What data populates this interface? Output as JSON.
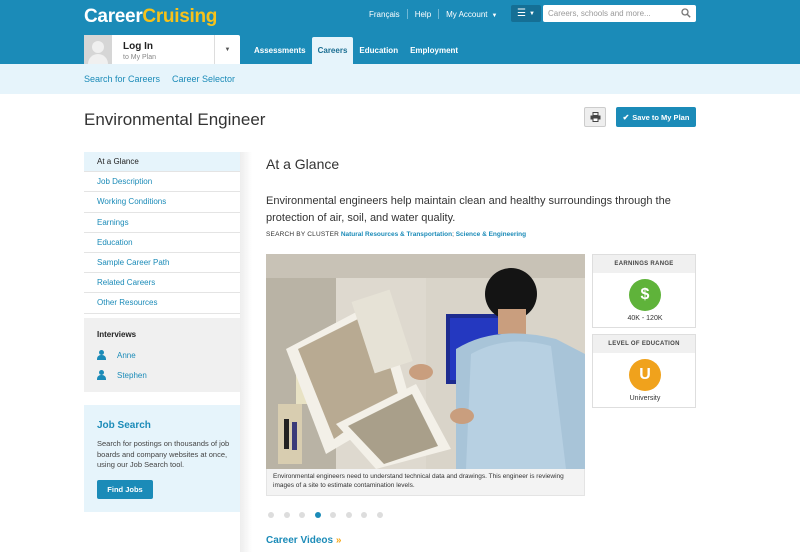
{
  "header": {
    "logo_part1": "Career",
    "logo_part2": "Cruising",
    "links": [
      "Français",
      "Help",
      "My Account"
    ],
    "search_placeholder": "Careers, schools and more..."
  },
  "login": {
    "title": "Log In",
    "subtitle": "to My Plan"
  },
  "main_nav": [
    "Assessments",
    "Careers",
    "Education",
    "Employment"
  ],
  "sub_nav": [
    "Search for Careers",
    "Career Selector"
  ],
  "page": {
    "title": "Environmental Engineer",
    "save_label": "Save to My Plan"
  },
  "sidebar": {
    "items": [
      "At a Glance",
      "Job Description",
      "Working Conditions",
      "Earnings",
      "Education",
      "Sample Career Path",
      "Related Careers",
      "Other Resources"
    ],
    "interviews_heading": "Interviews",
    "interviews": [
      "Anne",
      "Stephen"
    ],
    "job_search": {
      "heading": "Job Search",
      "text": "Search for postings on thousands of job boards and company websites at once, using our Job Search tool.",
      "button": "Find Jobs"
    }
  },
  "content": {
    "heading": "At a Glance",
    "description": "Environmental engineers help maintain clean and healthy surroundings through the protection of air, soil, and water quality.",
    "cluster_label": "SEARCH BY CLUSTER",
    "clusters": [
      "Natural Resources & Transportation",
      "Science & Engineering"
    ],
    "caption": "Environmental engineers need to understand technical data and drawings. This engineer is reviewing images of a site to estimate contamination levels.",
    "slides_total": 8,
    "slide_active": 4,
    "videos_label": "Career Videos"
  },
  "cards": {
    "earnings": {
      "heading": "EARNINGS RANGE",
      "symbol": "$",
      "value": "40K - 120K",
      "color": "#5fb33a"
    },
    "education": {
      "heading": "LEVEL OF EDUCATION",
      "symbol": "U",
      "value": "University",
      "color": "#f0a21c"
    }
  },
  "colors": {
    "brand": "#1b8bb8",
    "logo_accent": "#f7c21a",
    "light_bg": "#e6f4fb"
  }
}
